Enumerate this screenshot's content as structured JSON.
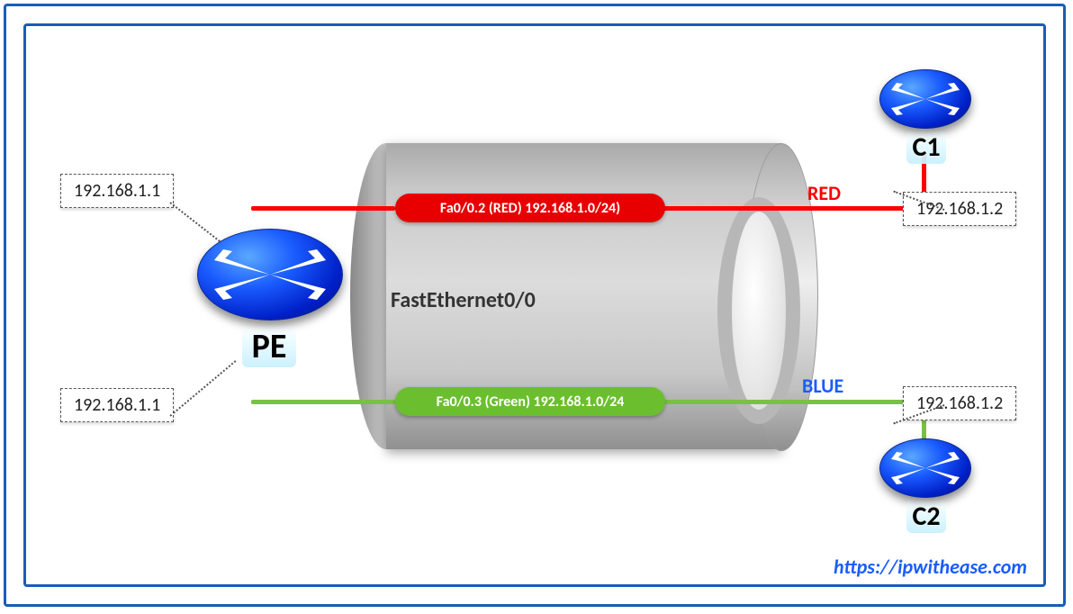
{
  "routers": {
    "pe": {
      "label": "PE"
    },
    "c1": {
      "label": "C1"
    },
    "c2": {
      "label": "C2"
    }
  },
  "ips": {
    "pe_red": "192.168.1.1",
    "pe_blue": "192.168.1.1",
    "c1": "192.168.1.2",
    "c2": "192.168.1.2"
  },
  "interfaces": {
    "main": "FastEthernet0/0",
    "red_pill": "Fa0/0.2 (RED) 192.168.1.0/24)",
    "green_pill": "Fa0/0.3 (Green) 192.168.1.0/24"
  },
  "link_labels": {
    "red": "RED",
    "blue": "BLUE"
  },
  "source": "https://ipwithease.com"
}
